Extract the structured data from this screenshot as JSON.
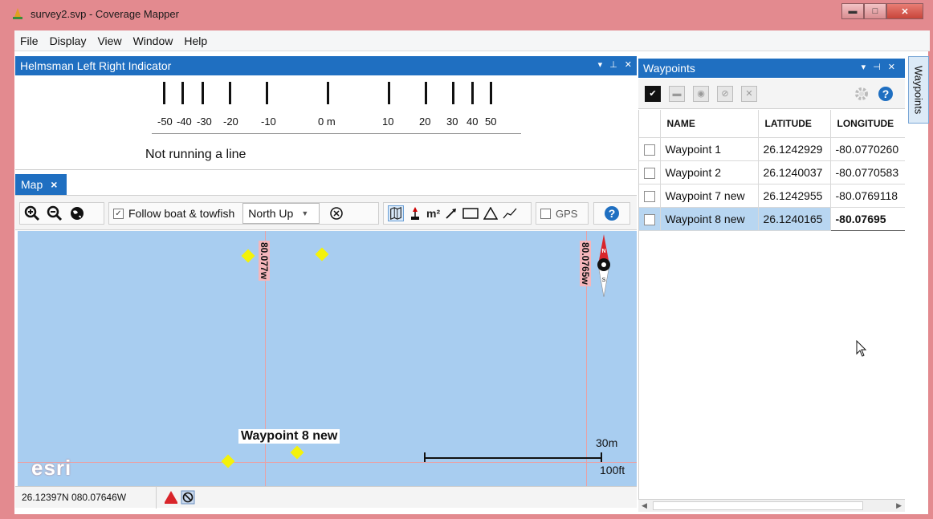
{
  "window": {
    "title": "survey2.svp - Coverage Mapper",
    "minimize_glyph": "▬",
    "maximize_glyph": "□",
    "close_glyph": "✕"
  },
  "menu": [
    "File",
    "Display",
    "View",
    "Window",
    "Help"
  ],
  "helmsman": {
    "title": "Helmsman Left Right Indicator",
    "tick_labels": [
      "-50",
      "-40",
      "-30",
      "-20",
      "-10",
      "0 m",
      "10",
      "20",
      "30",
      "40",
      "50"
    ],
    "status": "Not running a line"
  },
  "map": {
    "tab_label": "Map",
    "tab_close": "×",
    "toolbar": {
      "follow_label": "Follow boat & towfish",
      "follow_checked": true,
      "orientation_value": "North Up",
      "area_label": "m²",
      "gps_label": "GPS",
      "gps_checked": false
    },
    "grid_labels": [
      "80.077w",
      "80.0765w"
    ],
    "waypoint_label": "Waypoint 8 new",
    "scale_metric": "30m",
    "scale_imperial": "100ft",
    "logo": "esri",
    "compass_letters": {
      "north": "N",
      "south": "S"
    }
  },
  "status_bar": {
    "coordinates": "26.12397N 080.07646W"
  },
  "waypoints": {
    "title": "Waypoints",
    "side_tab_label": "Waypoints",
    "columns": [
      "NAME",
      "LATITUDE",
      "LONGITUDE"
    ],
    "rows": [
      {
        "name": "Waypoint 1",
        "latitude": "26.1242929",
        "longitude": "-80.0770260"
      },
      {
        "name": "Waypoint 2",
        "latitude": "26.1240037",
        "longitude": "-80.0770583"
      },
      {
        "name": "Waypoint 7 new",
        "latitude": "26.1242955",
        "longitude": "-80.0769118"
      },
      {
        "name": "Waypoint 8 new",
        "latitude": "26.1240165",
        "longitude": "-80.07695"
      }
    ],
    "selected_row": 3
  },
  "colors": {
    "title_bar": "#e38a8f",
    "panel_header": "#1f6fc1",
    "map_water": "#a8cdf0",
    "grid_line": "#e7a2a6",
    "waypoint_marker": "#f4f20a",
    "selection": "#b8d6f1"
  }
}
